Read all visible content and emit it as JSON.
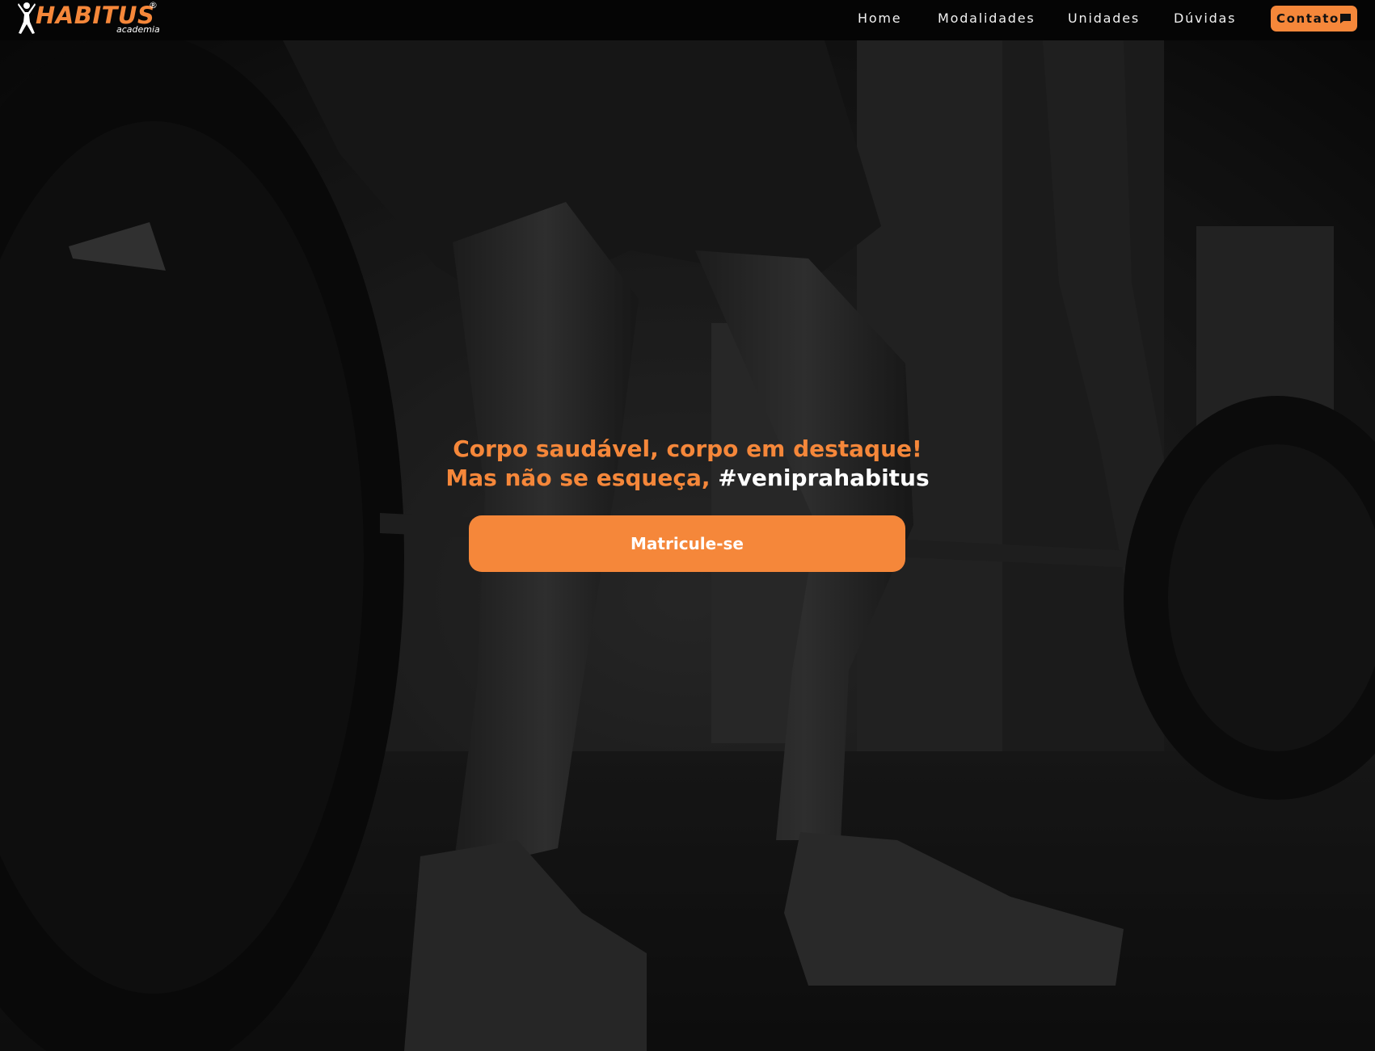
{
  "brand": {
    "name": "HABITUS",
    "subtitle": "academia",
    "registered_mark": "®",
    "accent_color": "#f5873a"
  },
  "nav": {
    "links": [
      {
        "label": "Home"
      },
      {
        "label": "Modalidades"
      },
      {
        "label": "Unidades"
      },
      {
        "label": "Dúvidas"
      }
    ],
    "contact": {
      "label": "Contato",
      "icon": "chat-bubble-icon"
    }
  },
  "hero": {
    "line1": "Corpo saudável, corpo em destaque!",
    "line2_prefix": "Mas não se esqueça,",
    "line2_hashtag": "#veniprahabitus",
    "cta_label": "Matricule-se",
    "background": "gym-deadlift-photo"
  }
}
